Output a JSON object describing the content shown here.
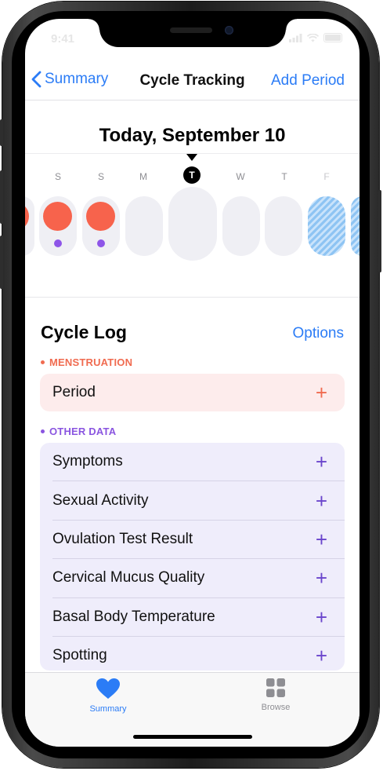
{
  "status": {
    "time": "9:41"
  },
  "nav": {
    "back_label": "Summary",
    "title": "Cycle Tracking",
    "action_label": "Add Period"
  },
  "calendar": {
    "date_title": "Today, September 10",
    "days": [
      "S",
      "S",
      "M",
      "T",
      "W",
      "T",
      "F"
    ],
    "today_index": 3
  },
  "log": {
    "title": "Cycle Log",
    "options_label": "Options",
    "menstruation_label": "MENSTRUATION",
    "period_label": "Period",
    "other_label": "OTHER DATA",
    "other_items": [
      "Symptoms",
      "Sexual Activity",
      "Ovulation Test Result",
      "Cervical Mucus Quality",
      "Basal Body Temperature",
      "Spotting"
    ]
  },
  "tabs": {
    "summary_label": "Summary",
    "browse_label": "Browse"
  },
  "colors": {
    "accent_blue": "#2b7cf6",
    "period_red": "#f7634c",
    "other_purple": "#8e55e8",
    "fertile_blue": "#8ec4f3"
  }
}
